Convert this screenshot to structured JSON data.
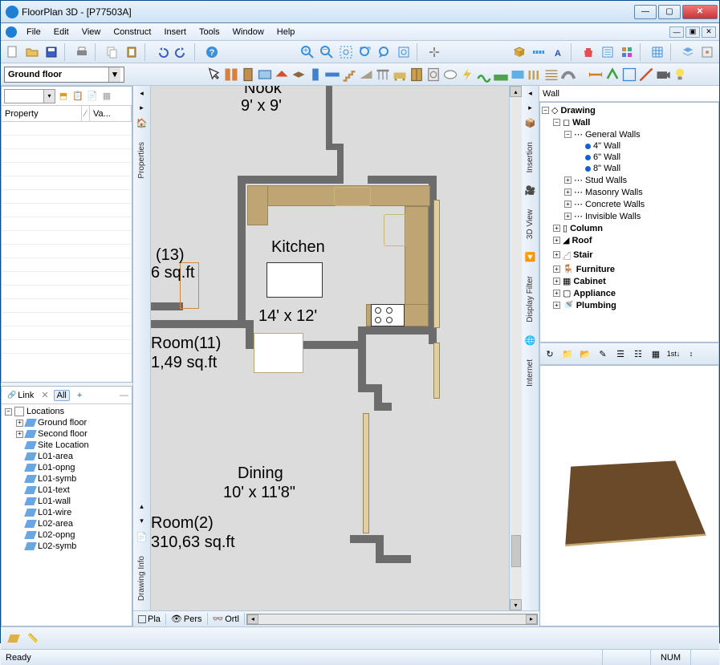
{
  "titlebar": {
    "app_title": "FloorPlan 3D - [P77503A]"
  },
  "menu": {
    "file": "File",
    "edit": "Edit",
    "view": "View",
    "construct": "Construct",
    "insert": "Insert",
    "tools": "Tools",
    "window": "Window",
    "help": "Help"
  },
  "floor_selector": {
    "value": "Ground floor"
  },
  "properties": {
    "col_property": "Property",
    "col_value": "Va..."
  },
  "locations_toolbar": {
    "link": "Link",
    "all": "All",
    "plus": "+"
  },
  "locations_tree": {
    "root": "Locations",
    "items": [
      "Ground floor",
      "Second floor",
      "Site Location",
      "L01-area",
      "L01-opng",
      "L01-symb",
      "L01-text",
      "L01-wall",
      "L01-wire",
      "L02-area",
      "L02-opng",
      "L02-symb"
    ]
  },
  "left_vtabs": {
    "properties": "Properties",
    "drawing_info": "Drawing Info"
  },
  "canvas": {
    "nook_label": "Nook",
    "nook_dim": "9' x 9'",
    "kitchen_label": "Kitchen",
    "kitchen_dim": "14' x 12'",
    "dining_label": "Dining",
    "dining_dim": "10' x 11'8\"",
    "room13_label": "(13)",
    "room13_area": "6 sq.ft",
    "room11_label": "Room(11)",
    "room11_area": "1,49 sq.ft",
    "room2_label": "Room(2)",
    "room2_area": "310,63 sq.ft"
  },
  "canvas_tabs": {
    "plan": "Pla",
    "perspective": "Pers",
    "ortho": "Ortl"
  },
  "right_vtabs": {
    "insertion": "Insertion",
    "view3d": "3D View",
    "display_filter": "Display Filter",
    "internet": "Internet"
  },
  "right_panel": {
    "title": "Wall",
    "tree": {
      "drawing": "Drawing",
      "wall": "Wall",
      "general_walls": "General Walls",
      "wall_4": "4\" Wall",
      "wall_6": "6\" Wall",
      "wall_8": "8\" Wall",
      "stud": "Stud Walls",
      "masonry": "Masonry Walls",
      "concrete": "Concrete Walls",
      "invisible": "Invisible Walls",
      "column": "Column",
      "roof": "Roof",
      "stair": "Stair",
      "furniture": "Furniture",
      "cabinet": "Cabinet",
      "appliance": "Appliance",
      "plumbing": "Plumbing"
    }
  },
  "statusbar": {
    "ready": "Ready",
    "num": "NUM"
  }
}
